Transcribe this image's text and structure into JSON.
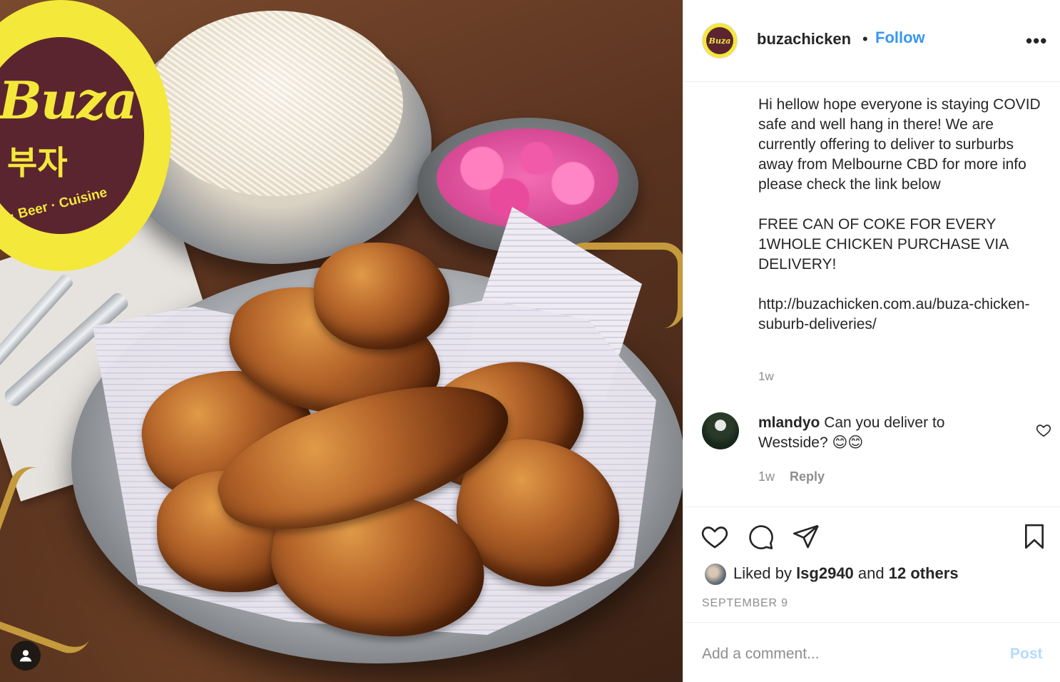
{
  "photo": {
    "logo_title": "Buza",
    "logo_korean": "부자",
    "logo_footer": "n · Beer · Cuisine"
  },
  "header": {
    "username": "buzachicken",
    "separator": "•",
    "follow_label": "Follow",
    "more_label": "•••",
    "avatar_text": "Buza"
  },
  "caption": {
    "text": "Hi hellow hope everyone is staying COVID safe and well hang in there! We are currently offering to deliver to surburbs away from Melbourne CBD for more info please check the link below\n\nFREE CAN OF COKE FOR EVERY 1WHOLE CHICKEN PURCHASE VIA DELIVERY!\n\nhttp://buzachicken.com.au/buza-chicken-suburb-deliveries/",
    "time": "1w"
  },
  "comment": {
    "username": "mlandyo",
    "text": " Can you deliver to Westside? 😊😊",
    "time": "1w",
    "reply_label": "Reply"
  },
  "actions": {
    "liked_by_prefix": "Liked by ",
    "liked_by_user": "lsg2940",
    "liked_by_and": " and ",
    "liked_by_others": "12 others",
    "date": "SEPTEMBER 9"
  },
  "add_comment": {
    "placeholder": "Add a comment...",
    "post_label": "Post"
  },
  "colors": {
    "accent": "#3897f0",
    "post_disabled": "#b3dbff",
    "muted": "#8e8e8e",
    "logo_yellow": "#f4e83a",
    "logo_maroon": "#5b2530"
  }
}
